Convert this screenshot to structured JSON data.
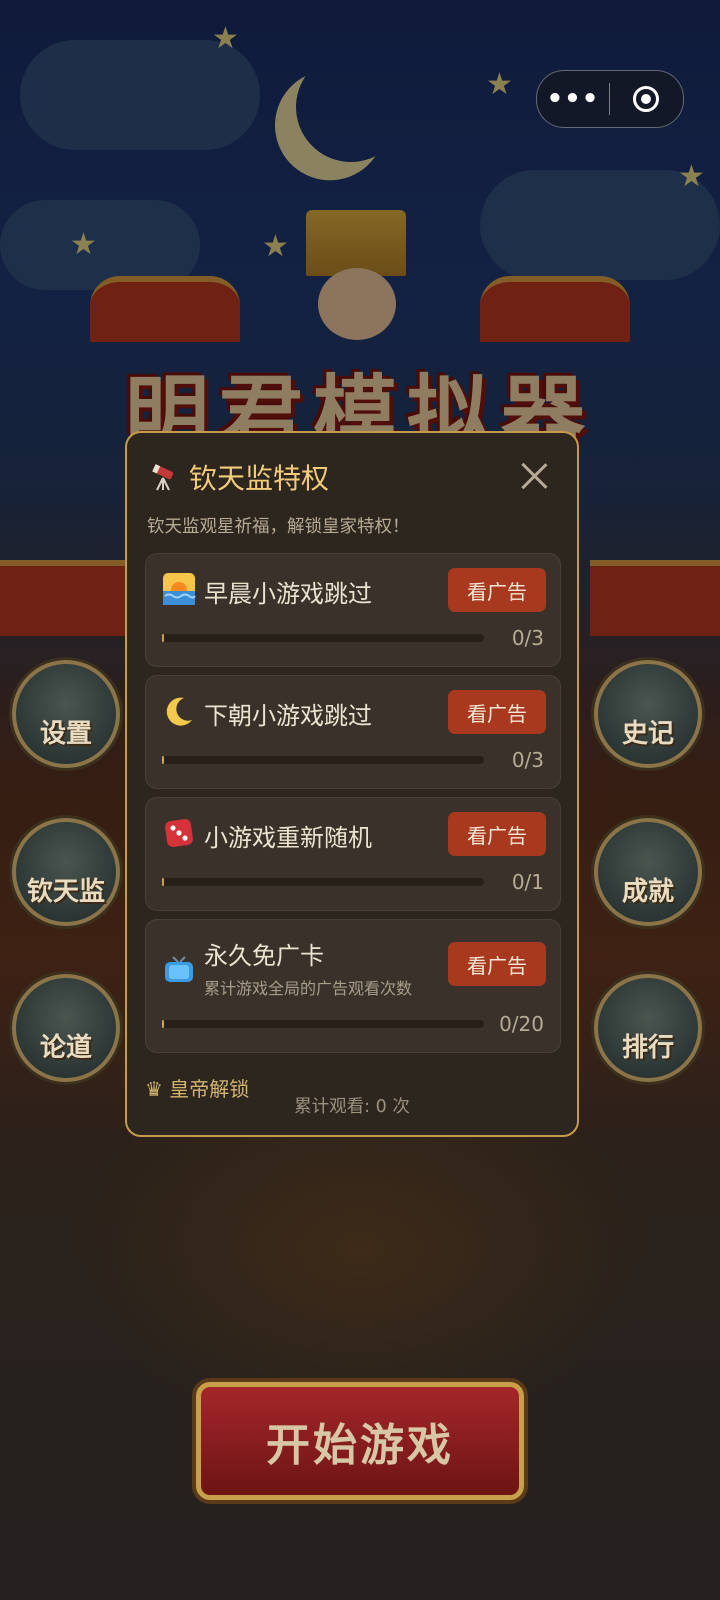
{
  "capsule": {
    "more_label": "•••"
  },
  "background": {
    "game_title": "明君模拟器",
    "left_buttons": [
      "设置",
      "钦天监",
      "论道"
    ],
    "right_buttons": [
      "史记",
      "成就",
      "排行"
    ],
    "start_label": "开始游戏"
  },
  "modal": {
    "title": "钦天监特权",
    "title_icon": "telescope-icon",
    "subtitle": "钦天监观星祈福，解锁皇家特权！",
    "cards": [
      {
        "icon": "sunrise-icon",
        "name": "早晨小游戏跳过",
        "button": "看广告",
        "progress": "0/3",
        "fraction": 0
      },
      {
        "icon": "crescent-moon-icon",
        "name": "下朝小游戏跳过",
        "button": "看广告",
        "progress": "0/3",
        "fraction": 0
      },
      {
        "icon": "dice-icon",
        "name": "小游戏重新随机",
        "button": "看广告",
        "progress": "0/1",
        "fraction": 0
      },
      {
        "icon": "tv-icon",
        "name": "永久免广卡",
        "description": "累计游戏全局的广告观看次数",
        "button": "看广告",
        "progress": "0/20",
        "fraction": 0
      }
    ],
    "emperor_section": "皇帝解锁",
    "footer": "累计观看: 0 次"
  },
  "colors": {
    "accent": "#c59a49",
    "ad_button": "#a8391f",
    "modal_bg": "#2d261f"
  }
}
